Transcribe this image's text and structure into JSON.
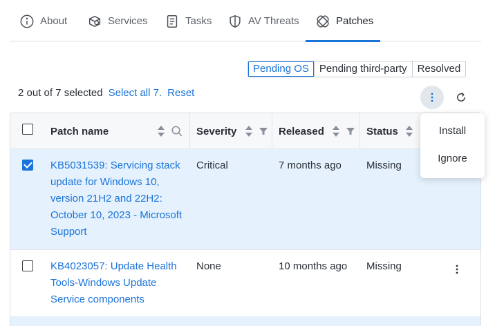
{
  "tabs": [
    {
      "label": "About",
      "icon": "info-icon"
    },
    {
      "label": "Services",
      "icon": "services-icon"
    },
    {
      "label": "Tasks",
      "icon": "tasks-icon"
    },
    {
      "label": "AV Threats",
      "icon": "shield-icon"
    },
    {
      "label": "Patches",
      "icon": "patches-icon",
      "active": true
    }
  ],
  "filter": {
    "options": [
      "Pending OS",
      "Pending third-party",
      "Resolved"
    ],
    "selected": "Pending OS"
  },
  "selection": {
    "count_text": "2 out of 7 selected",
    "select_all": "Select all 7.",
    "reset": "Reset"
  },
  "table": {
    "headers": {
      "patch_name": "Patch name",
      "severity": "Severity",
      "released": "Released",
      "status": "Status"
    },
    "rows": [
      {
        "name": "KB5031539: Servicing stack update for Windows 10, version 21H2 and 22H2: October 10, 2023 - Microsoft Support",
        "severity": "Critical",
        "released": "7 months ago",
        "status": "Missing",
        "checked": true
      },
      {
        "name": "KB4023057: Update Health Tools-Windows Update Service components",
        "severity": "None",
        "released": "10 months ago",
        "status": "Missing",
        "checked": false
      }
    ]
  },
  "menu": {
    "items": [
      "Install",
      "Ignore"
    ]
  },
  "colors": {
    "accent": "#1a73d9",
    "selected_row": "#e5f2fd"
  }
}
